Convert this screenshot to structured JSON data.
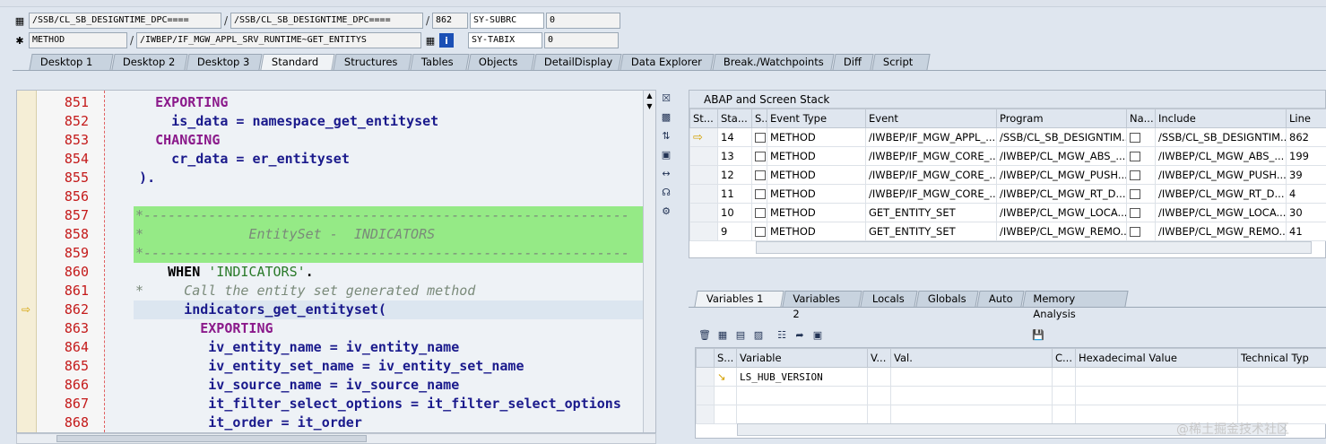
{
  "header": {
    "row1": {
      "class_field": "/SSB/CL_SB_DESIGNTIME_DPC====",
      "include_field": "/SSB/CL_SB_DESIGNTIME_DPC====",
      "line_field": "862",
      "sysvar_name": "SY-SUBRC",
      "sysvar_value": "0"
    },
    "row2": {
      "type_field": "METHOD",
      "event_field": "/IWBEP/IF_MGW_APPL_SRV_RUNTIME~GET_ENTITYS",
      "sysvar_name": "SY-TABIX",
      "sysvar_value": "0"
    },
    "separator": "/"
  },
  "tabs": [
    "Desktop 1",
    "Desktop 2",
    "Desktop 3",
    "Standard",
    "Structures",
    "Tables",
    "Objects",
    "DetailDisplay",
    "Data Explorer",
    "Break./Watchpoints",
    "Diff",
    "Script"
  ],
  "active_tab": "Standard",
  "code": {
    "lines": [
      {
        "n": "851",
        "text": "    EXPORTING",
        "kind": "kw",
        "indent": 100
      },
      {
        "n": "852",
        "text": "      is_data = namespace_get_entityset",
        "kind": "id",
        "indent": 100
      },
      {
        "n": "853",
        "text": "    CHANGING",
        "kind": "kw",
        "indent": 100
      },
      {
        "n": "854",
        "text": "      cr_data = er_entityset",
        "kind": "id",
        "indent": 100
      },
      {
        "n": "855",
        "text": "  ).",
        "kind": "id",
        "indent": 78
      },
      {
        "n": "856",
        "text": "",
        "kind": "id",
        "indent": 0
      },
      {
        "n": "857",
        "text": "*------------------------------------------------------------",
        "kind": "cm",
        "indent": 12
      },
      {
        "n": "858",
        "text": "*             EntitySet -  INDICATORS",
        "kind": "cm",
        "indent": 12
      },
      {
        "n": "859",
        "text": "*------------------------------------------------------------",
        "kind": "cm",
        "indent": 12
      },
      {
        "n": "860",
        "text": "    WHEN 'INDICATORS'.",
        "kind": "when",
        "indent": 12
      },
      {
        "n": "861",
        "text": "*     Call the entity set generated method",
        "kind": "cm",
        "indent": 12
      },
      {
        "n": "862",
        "text": "      indicators_get_entityset(",
        "kind": "id",
        "indent": 12
      },
      {
        "n": "863",
        "text": "        EXPORTING",
        "kind": "kw",
        "indent": 12
      },
      {
        "n": "864",
        "text": "         iv_entity_name = iv_entity_name",
        "kind": "id",
        "indent": 12
      },
      {
        "n": "865",
        "text": "         iv_entity_set_name = iv_entity_set_name",
        "kind": "id",
        "indent": 12
      },
      {
        "n": "866",
        "text": "         iv_source_name = iv_source_name",
        "kind": "id",
        "indent": 12
      },
      {
        "n": "867",
        "text": "         it_filter_select_options = it_filter_select_options",
        "kind": "id",
        "indent": 12
      },
      {
        "n": "868",
        "text": "         it_order = it_order",
        "kind": "id",
        "indent": 12
      }
    ],
    "current_line": "862"
  },
  "stack": {
    "title": "ABAP and Screen Stack",
    "columns": [
      "St...",
      "Sta...",
      "S...",
      "Event Type",
      "Event",
      "Program",
      "Na...",
      "Include",
      "Line"
    ],
    "rows": [
      {
        "status": "⇨",
        "level": "14",
        "type": "METHOD",
        "event": "/IWBEP/IF_MGW_APPL_...",
        "program": "/SSB/CL_SB_DESIGNTIM...",
        "include": "/SSB/CL_SB_DESIGNTIM...",
        "line": "862"
      },
      {
        "status": "",
        "level": "13",
        "type": "METHOD",
        "event": "/IWBEP/IF_MGW_CORE_...",
        "program": "/IWBEP/CL_MGW_ABS_...",
        "include": "/IWBEP/CL_MGW_ABS_...",
        "line": "199"
      },
      {
        "status": "",
        "level": "12",
        "type": "METHOD",
        "event": "/IWBEP/IF_MGW_CORE_...",
        "program": "/IWBEP/CL_MGW_PUSH...",
        "include": "/IWBEP/CL_MGW_PUSH...",
        "line": "39"
      },
      {
        "status": "",
        "level": "11",
        "type": "METHOD",
        "event": "/IWBEP/IF_MGW_CORE_...",
        "program": "/IWBEP/CL_MGW_RT_D...",
        "include": "/IWBEP/CL_MGW_RT_D...",
        "line": "4"
      },
      {
        "status": "",
        "level": "10",
        "type": "METHOD",
        "event": "GET_ENTITY_SET",
        "program": "/IWBEP/CL_MGW_LOCA...",
        "include": "/IWBEP/CL_MGW_LOCA...",
        "line": "30"
      },
      {
        "status": "",
        "level": "9",
        "type": "METHOD",
        "event": "GET_ENTITY_SET",
        "program": "/IWBEP/CL_MGW_REMO...",
        "include": "/IWBEP/CL_MGW_REMO...",
        "line": "41"
      }
    ]
  },
  "var_tabs": [
    "Variables 1",
    "Variables 2",
    "Locals",
    "Globals",
    "Auto",
    "Memory Analysis"
  ],
  "active_var_tab": "Variables 1",
  "vars": {
    "columns": [
      "S...",
      "Variable",
      "V...",
      "Val.",
      "C...",
      "Hexadecimal Value",
      "Technical Typ"
    ],
    "rows": [
      {
        "variable": "LS_HUB_VERSION"
      }
    ]
  },
  "watermark": "@稀土掘金技术社区"
}
